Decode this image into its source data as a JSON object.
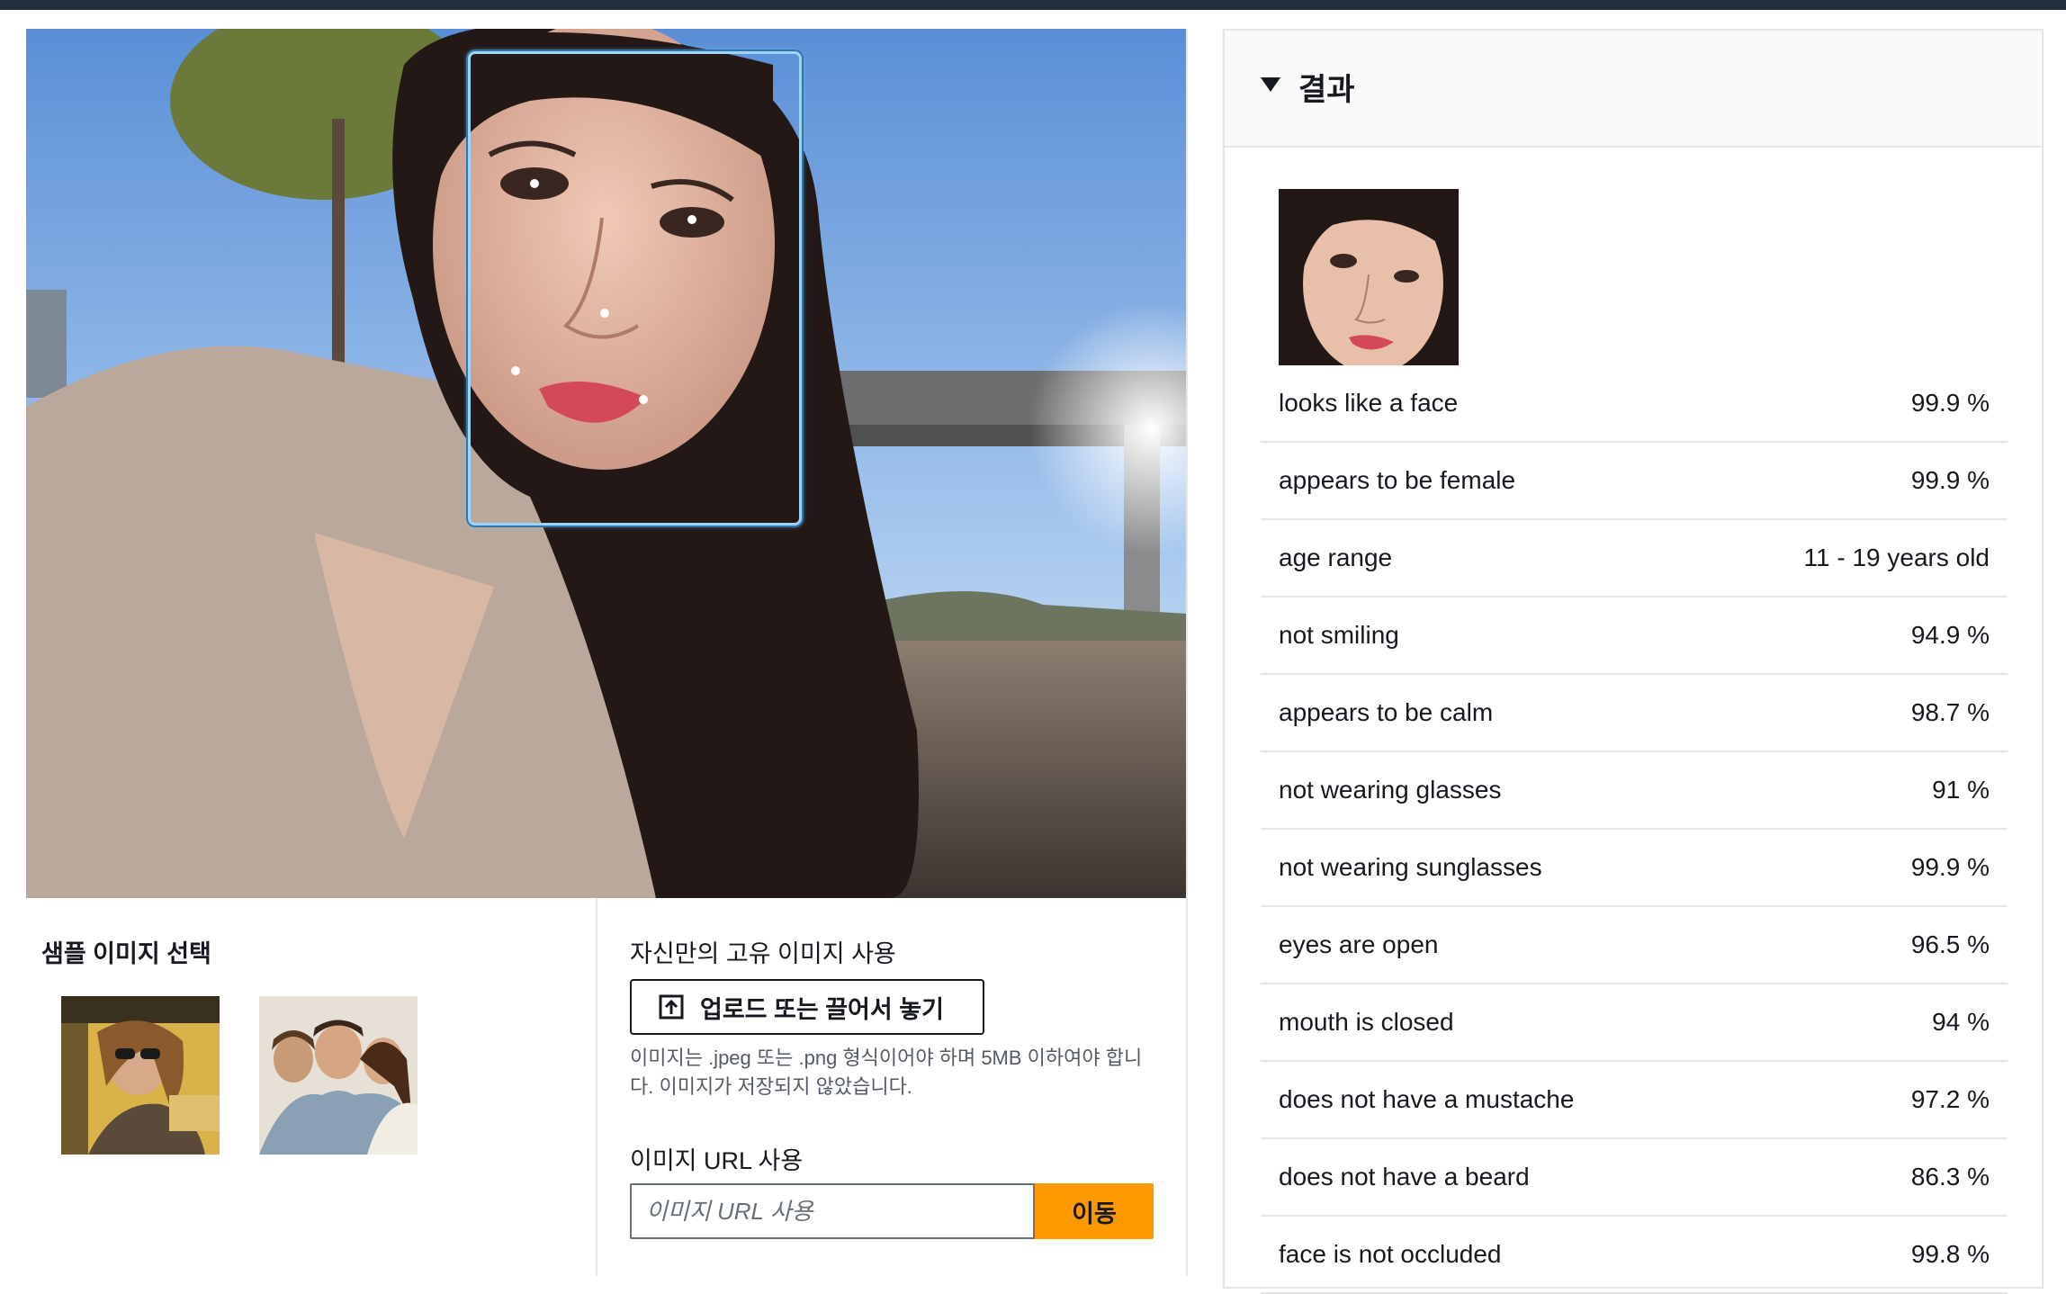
{
  "samples": {
    "title": "샘플 이미지 선택"
  },
  "upload": {
    "title": "자신만의 고유 이미지 사용",
    "button_label": "업로드 또는 끌어서 놓기",
    "help_text": "이미지는 .jpeg 또는 .png 형식이어야 하며 5MB 이하여야 합니다. 이미지가 저장되지 않았습니다.",
    "url_title": "이미지 URL 사용",
    "url_placeholder": "이미지 URL 사용",
    "go_label": "이동"
  },
  "results": {
    "title": "결과",
    "rows": [
      {
        "label": "looks like a face",
        "value": "99.9 %"
      },
      {
        "label": "appears to be female",
        "value": "99.9 %"
      },
      {
        "label": "age range",
        "value": "11 - 19 years old"
      },
      {
        "label": "not smiling",
        "value": "94.9 %"
      },
      {
        "label": "appears to be calm",
        "value": "98.7 %"
      },
      {
        "label": "not wearing glasses",
        "value": "91 %"
      },
      {
        "label": "not wearing sunglasses",
        "value": "99.9 %"
      },
      {
        "label": "eyes are open",
        "value": "96.5 %"
      },
      {
        "label": "mouth is closed",
        "value": "94 %"
      },
      {
        "label": "does not have a mustache",
        "value": "97.2 %"
      },
      {
        "label": "does not have a beard",
        "value": "86.3 %"
      },
      {
        "label": "face is not occluded",
        "value": "99.8 %"
      }
    ]
  },
  "colors": {
    "accent": "#ff9900",
    "face_box": "#9fd3f5",
    "topbar": "#232f3e"
  }
}
